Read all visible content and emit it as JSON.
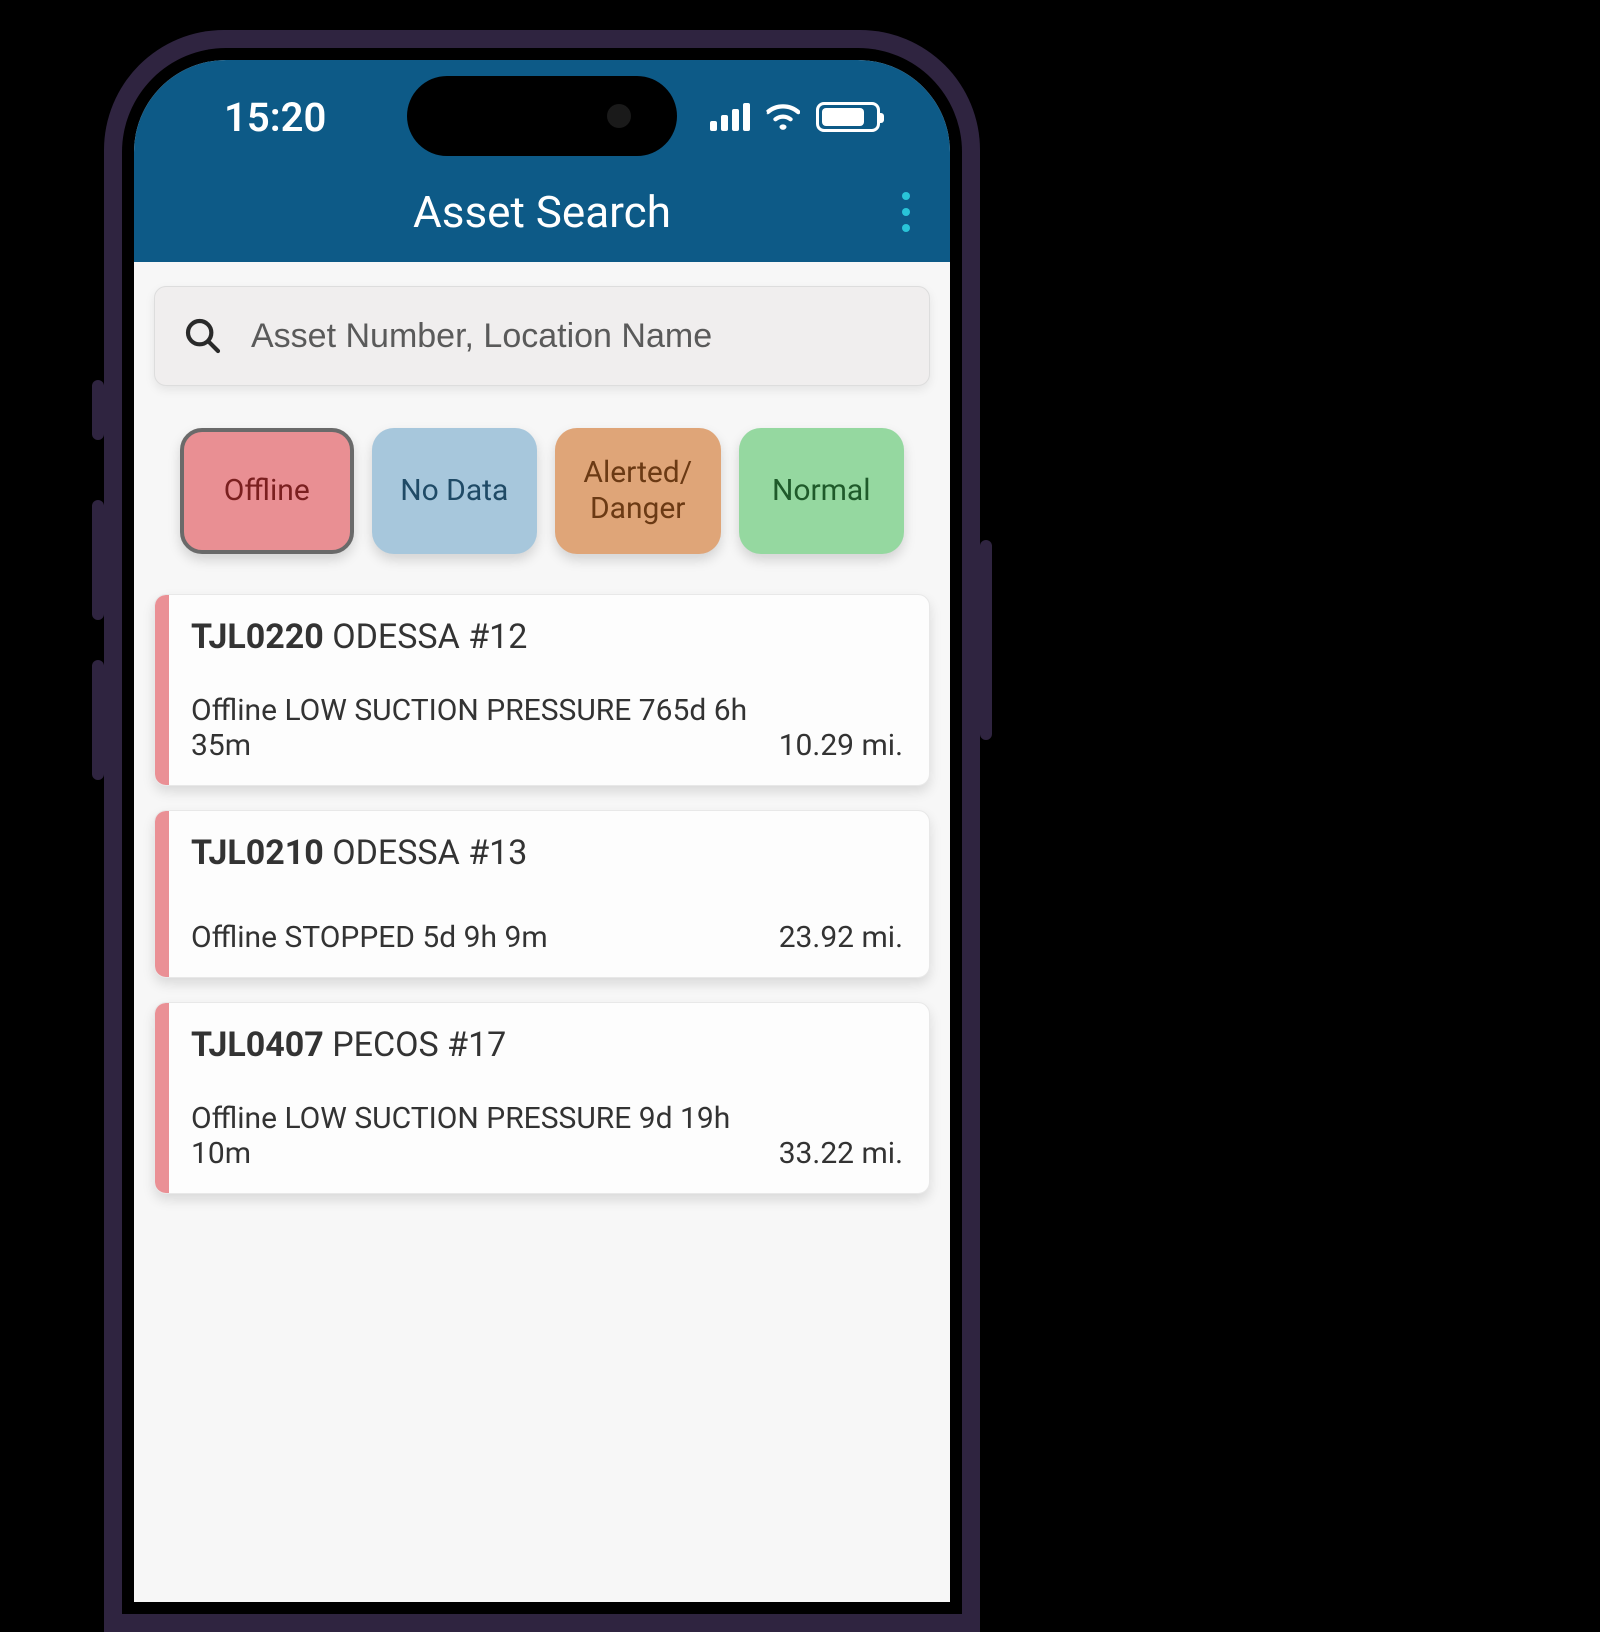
{
  "status": {
    "time": "15:20"
  },
  "header": {
    "title": "Asset Search"
  },
  "search": {
    "placeholder": "Asset Number, Location Name"
  },
  "filters": [
    {
      "key": "offline",
      "label": "Offline",
      "selected": true
    },
    {
      "key": "nodata",
      "label": "No Data",
      "selected": false
    },
    {
      "key": "alerted",
      "label": "Alerted/\nDanger",
      "selected": false
    },
    {
      "key": "normal",
      "label": "Normal",
      "selected": false
    }
  ],
  "results": [
    {
      "asset_id": "TJL0220",
      "location": "ODESSA #12",
      "status_line": "Offline LOW SUCTION PRESSURE 765d 6h 35m",
      "distance": "10.29 mi."
    },
    {
      "asset_id": "TJL0210",
      "location": "ODESSA #13",
      "status_line": "Offline STOPPED 5d 9h 9m",
      "distance": "23.92 mi."
    },
    {
      "asset_id": "TJL0407",
      "location": "PECOS #17",
      "status_line": "Offline LOW SUCTION PRESSURE 9d 19h 10m",
      "distance": "33.22 mi."
    }
  ]
}
